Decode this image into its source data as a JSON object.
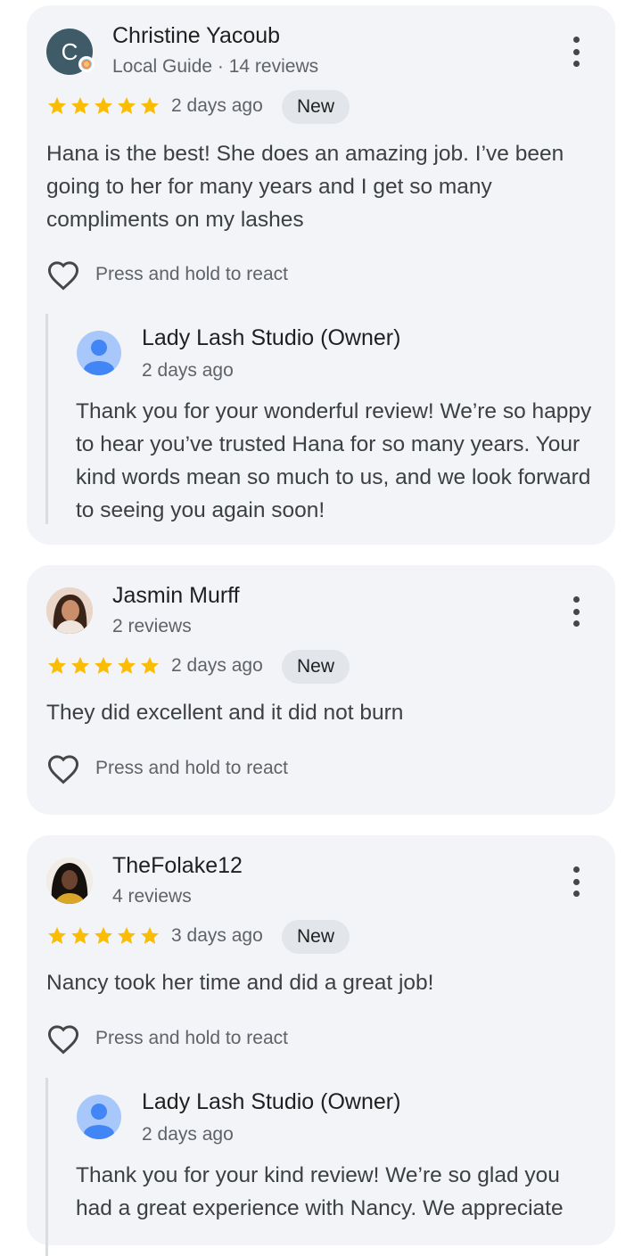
{
  "reviews": [
    {
      "author": "Christine Yacoub",
      "avatar_letter": "C",
      "meta": "Local Guide · 14 reviews",
      "rating": 5,
      "date": "2 days ago",
      "badge": "New",
      "text": "Hana is the best! She does an amazing job. I’ve been going to her for many years and I get so many compliments on my lashes",
      "react_label": "Press and hold to react",
      "reply": {
        "author": "Lady Lash Studio (Owner)",
        "date": "2 days ago",
        "text": "Thank you for your wonderful review! We’re so happy to hear you’ve trusted Hana for so many years. Your kind words mean so much to us, and we look forward to seeing you again soon!"
      }
    },
    {
      "author": "Jasmin Murff",
      "meta": "2 reviews",
      "rating": 5,
      "date": "2 days ago",
      "badge": "New",
      "text": "They did excellent and it did not burn",
      "react_label": "Press and hold to react"
    },
    {
      "author": "TheFolake12",
      "meta": "4 reviews",
      "rating": 5,
      "date": "3 days ago",
      "badge": "New",
      "text": "Nancy took her time and did a great job!",
      "react_label": "Press and hold to react",
      "reply": {
        "author": "Lady Lash Studio (Owner)",
        "date": "2 days ago",
        "text": "Thank you for your kind review! We’re so glad you had a great experience with Nancy. We appreciate"
      }
    }
  ],
  "icons": {
    "star": "star-icon",
    "heart": "heart-outline-icon",
    "more": "more-vert-icon",
    "owner": "person-icon"
  },
  "colors": {
    "star": "#fbbc04",
    "card_bg": "#f2f4f7",
    "badge_bg": "#e2e5e9",
    "owner_avatar": "#a8c7fa"
  }
}
